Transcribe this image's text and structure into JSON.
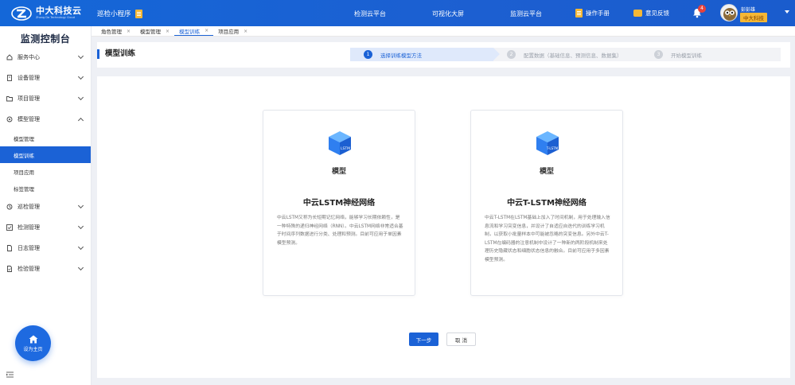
{
  "topbar": {
    "logo_name": "中大科技云",
    "logo_sub": "Zhong Da Technology Cloud",
    "mini_program": "巡检小程序",
    "nav": [
      "检测云平台",
      "可视化大屏",
      "监测云平台"
    ],
    "manual": "操作手册",
    "feedback": "意见反馈",
    "notification_count": "4",
    "user_name": "彭彭雄",
    "user_org": "中大科技"
  },
  "sidebar": {
    "title": "监测控制台",
    "menu": [
      {
        "label": "服务中心"
      },
      {
        "label": "设备管理"
      },
      {
        "label": "项目管理"
      },
      {
        "label": "模型管理"
      },
      {
        "label": "巡检管理"
      },
      {
        "label": "检测管理"
      },
      {
        "label": "日志管理"
      },
      {
        "label": "检验管理"
      }
    ],
    "model_sub": [
      "模型管理",
      "模型训练",
      "项目应用",
      "标签管理"
    ],
    "home_label": "设为主页"
  },
  "tabs": [
    {
      "label": "角色管理",
      "close": "×"
    },
    {
      "label": "模型管理",
      "close": "×"
    },
    {
      "label": "模型训练",
      "close": "×"
    },
    {
      "label": "项目应用",
      "close": "×"
    }
  ],
  "header": {
    "title": "模型训练",
    "steps": [
      {
        "num": "1",
        "label": "选择训练模型方法"
      },
      {
        "num": "2",
        "label": "配置数据（基础信息、预测信息、数据集）"
      },
      {
        "num": "3",
        "label": "开始模型训练"
      }
    ]
  },
  "cards": [
    {
      "cube_text": "LSTM",
      "model_label": "模型",
      "name": "中云LSTM神经网络",
      "desc": "中云LSTM又称为长短期记忆网络，能够学习长期依赖性，是一种特殊的递归神经网络（RNN）。中云LSTM网络非常适合基于时间序列数据进行分类、处理和预测。目前可应用于单因素模型预测。"
    },
    {
      "cube_text": "T-LSTM",
      "model_label": "模型",
      "name": "中云T-LSTM神经网络",
      "desc": "中云T-LSTM在LSTM基础上加入了时间机制，用于处理输入信息流和学习突变信息，并设计了自适应自迭代的训练学习机制，以获取小批量样本中可能被忽略的突变信息。另外中云T-LSTM在编码器的注意机制中设计了一种新的两阶段机制来处理历史隐藏状态和细胞状态信息的融合。目前可应用于多因素模型预测。"
    }
  ],
  "buttons": {
    "next": "下一步",
    "cancel": "取 消"
  },
  "colors": {
    "primary": "#1b62d6",
    "accent": "#f5b735",
    "badge": "#e8423b"
  }
}
